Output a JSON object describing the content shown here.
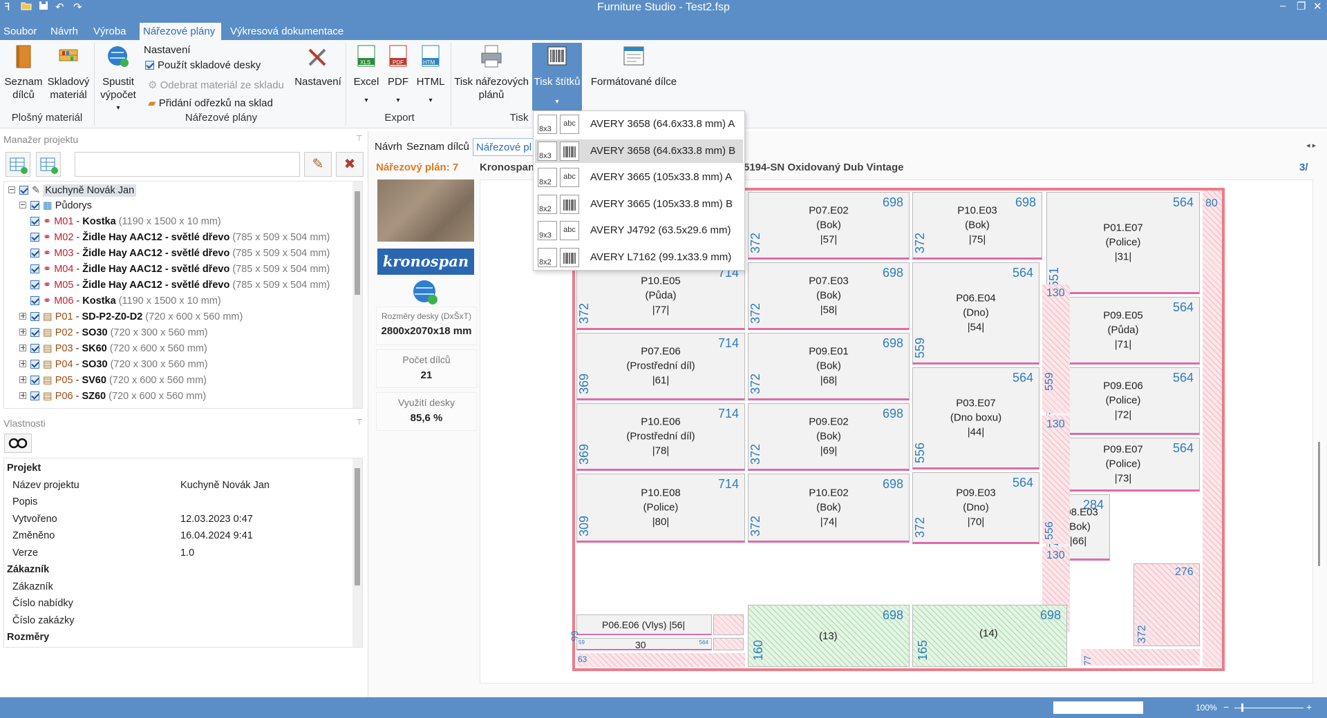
{
  "app": {
    "title": "Furniture Studio - Test2.fsp",
    "quick_access": [
      "folder-open-icon",
      "save-icon",
      "undo-icon",
      "redo-icon"
    ]
  },
  "window_controls": {
    "minimize": "–",
    "maximize": "❐",
    "close": "✕"
  },
  "menu_tabs": [
    {
      "label": "Soubor"
    },
    {
      "label": "Návrh"
    },
    {
      "label": "Výroba"
    },
    {
      "label": "Nářezové plány",
      "active": true
    },
    {
      "label": "Výkresová dokumentace"
    }
  ],
  "ribbon": {
    "seznam_dilcu": "Seznam\ndílců",
    "skladovy_material": "Skladový\nmateriál",
    "spustit_vypocet": "Spustit\nvýpočet",
    "nastaveni_header": "Nastavení",
    "pouzit_skladove": "Použít skladové desky",
    "odebrat_material": "Odebrat materiál ze skladu",
    "pridani_odrezku": "Přidání  odřezků na sklad",
    "nastaveni_btn": "Nastavení",
    "excel": "Excel",
    "pdf": "PDF",
    "html": "HTML",
    "tisk_narezovych": "Tisk nářezových\nplánů",
    "tisk_stitku": "Tisk štítků",
    "formatovane_dilce": "Formátované dílce",
    "groups": {
      "plosny_material": "Plošný materiál",
      "narezove_plany": "Nářezové plány",
      "export": "Export",
      "tisk": "Tisk"
    }
  },
  "project_manager": {
    "header": "Manažer projektu",
    "search_value": "",
    "tree": [
      {
        "text": "Kuchyně Novák Jan",
        "kind": "root"
      },
      {
        "text": "Půdorys",
        "kind": "folder"
      },
      {
        "code": "M01",
        "name": "Kostka",
        "dims": "(1190 x 1500 x 10 mm)"
      },
      {
        "code": "M02",
        "name": "Židle Hay AAC12 - světlé dřevo",
        "dims": "(785 x 509 x 504 mm)"
      },
      {
        "code": "M03",
        "name": "Židle Hay AAC12 - světlé dřevo",
        "dims": "(785 x 509 x 504 mm)"
      },
      {
        "code": "M04",
        "name": "Židle Hay AAC12 - světlé dřevo",
        "dims": "(785 x 509 x 504 mm)"
      },
      {
        "code": "M05",
        "name": "Židle Hay AAC12 - světlé dřevo",
        "dims": "(785 x 509 x 504 mm)"
      },
      {
        "code": "M06",
        "name": "Kostka",
        "dims": "(1190 x 1500 x 10 mm)"
      },
      {
        "code": "P01",
        "name": "SD-P2-Z0-D2",
        "dims": "(720 x 600 x 560 mm)"
      },
      {
        "code": "P02",
        "name": "SO30",
        "dims": "(720 x 300 x 560 mm)"
      },
      {
        "code": "P03",
        "name": "SK60",
        "dims": "(720 x 600 x 560 mm)"
      },
      {
        "code": "P04",
        "name": "SO30",
        "dims": "(720 x 300 x 560 mm)"
      },
      {
        "code": "P05",
        "name": "SV60",
        "dims": "(720 x 600 x 560 mm)"
      },
      {
        "code": "P06",
        "name": "SZ60",
        "dims": "(720 x 600 x 560 mm)"
      }
    ]
  },
  "properties": {
    "header": "Vlastnosti",
    "rows": [
      {
        "k": "Projekt",
        "v": "",
        "cat": true
      },
      {
        "k": "Název projektu",
        "v": "Kuchyně Novák Jan"
      },
      {
        "k": "Popis",
        "v": ""
      },
      {
        "k": "Vytvořeno",
        "v": "12.03.2023 0:47"
      },
      {
        "k": "Změněno",
        "v": "16.04.2024 9:41"
      },
      {
        "k": "Verze",
        "v": "1.0"
      },
      {
        "k": "Zákazník",
        "v": "",
        "cat": true
      },
      {
        "k": "Zákazník",
        "v": ""
      },
      {
        "k": "Číslo nabídky",
        "v": ""
      },
      {
        "k": "Číslo zakázky",
        "v": ""
      },
      {
        "k": "Rozměry",
        "v": "",
        "cat": true
      }
    ]
  },
  "doc_tabs": [
    "Návrh",
    "Seznam dílců",
    "Nářezové pl"
  ],
  "plan": {
    "title": "Nářezový plán: 7",
    "material_prefix": "Kronospan",
    "material_suffix": "5194-SN Oxidovaný Dub Vintage",
    "page": "3/",
    "brand": "kronospan",
    "board_size_label": "Rozměry desky (DxŠxT)",
    "board_size": "2800x2070x18 mm",
    "parts_label": "Počet dílců",
    "parts_count": "21",
    "usage_label": "Využití desky",
    "usage_value": "85,6 %"
  },
  "dropdown": [
    {
      "grid": "8x3",
      "type": "abc",
      "label": "AVERY 3658 (64.6x33.8 mm) A"
    },
    {
      "grid": "8x3",
      "type": "barcode",
      "label": "AVERY 3658 (64.6x33.8 mm) B",
      "selected": true
    },
    {
      "grid": "8x2",
      "type": "abc",
      "label": "AVERY 3665 (105x33.8 mm) A"
    },
    {
      "grid": "8x2",
      "type": "barcode",
      "label": "AVERY 3665 (105x33.8 mm) B"
    },
    {
      "grid": "9x3",
      "type": "abc",
      "label": "AVERY J4792 (63.5x29.6 mm)"
    },
    {
      "grid": "8x2",
      "type": "barcode",
      "label": "AVERY L7162 (99.1x33.9 mm)"
    }
  ],
  "parts": [
    {
      "id": "P07.E02",
      "role": "(Bok)",
      "num": "|57|",
      "w": "698",
      "h": "372"
    },
    {
      "id": "P10.E03",
      "role": "(Bok)",
      "num": "|75|",
      "w": "698",
      "h": "372"
    },
    {
      "id": "P01.E07",
      "role": "(Police)",
      "num": "|31|",
      "w": "564",
      "h": "551"
    },
    {
      "id": "P10.E05",
      "role": "(Půda)",
      "num": "|77|",
      "w": "714",
      "h": "372"
    },
    {
      "id": "P07.E03",
      "role": "(Bok)",
      "num": "|58|",
      "w": "698",
      "h": "372"
    },
    {
      "id": "P06.E04",
      "role": "(Dno)",
      "num": "|54|",
      "w": "564",
      "h": "559"
    },
    {
      "id": "P09.E05",
      "role": "(Půda)",
      "num": "|71|",
      "w": "564",
      "h": "367"
    },
    {
      "id": "P07.E06",
      "role": "(Prostřední díl)",
      "num": "|61|",
      "w": "714",
      "h": "369"
    },
    {
      "id": "P09.E01",
      "role": "(Bok)",
      "num": "|68|",
      "w": "698",
      "h": "372"
    },
    {
      "id": "P03.E07",
      "role": "(Dno boxu)",
      "num": "|44|",
      "w": "564",
      "h": "556"
    },
    {
      "id": "P09.E06",
      "role": "(Police)",
      "num": "|72|",
      "w": "564",
      "h": "367"
    },
    {
      "id": "P10.E06",
      "role": "(Prostřední díl)",
      "num": "|78|",
      "w": "714",
      "h": "369"
    },
    {
      "id": "P09.E02",
      "role": "(Bok)",
      "num": "|69|",
      "w": "698",
      "h": "372"
    },
    {
      "id": "P09.E07",
      "role": "(Police)",
      "num": "|73|",
      "w": "564",
      "h": "286"
    },
    {
      "id": "P10.E08",
      "role": "(Police)",
      "num": "|80|",
      "w": "714",
      "h": "309"
    },
    {
      "id": "P10.E02",
      "role": "(Bok)",
      "num": "|74|",
      "w": "698",
      "h": "372"
    },
    {
      "id": "P09.E03",
      "role": "(Dno)",
      "num": "|70|",
      "w": "564",
      "h": "372"
    },
    {
      "id": "P08.E03",
      "role": "(Bok)",
      "num": "|66|",
      "w": "284",
      "h": "372"
    }
  ],
  "strip_labels": {
    "vlys": "P06.E06 (Vlys) |56|",
    "vlys_h": "99",
    "s30": "30",
    "s59": "59",
    "s564": "564",
    "s63": "63",
    "off13": "(13)",
    "off13_w": "698",
    "off13_h": "160",
    "off14": "(14)",
    "off14_w": "698",
    "off14_h": "165",
    "w130a": "130",
    "h559": "559",
    "w130b": "130",
    "h556": "556",
    "w130c": "130",
    "h372": "372",
    "w80": "80",
    "w276": "276",
    "h372b": "372",
    "h77": "77"
  },
  "status": {
    "zoom": "100%"
  },
  "colors": {
    "accent": "#5b8ec6",
    "part_width": "#2d7dbd",
    "sheet_border": "#f07a86",
    "plan_title": "#e07a20"
  }
}
